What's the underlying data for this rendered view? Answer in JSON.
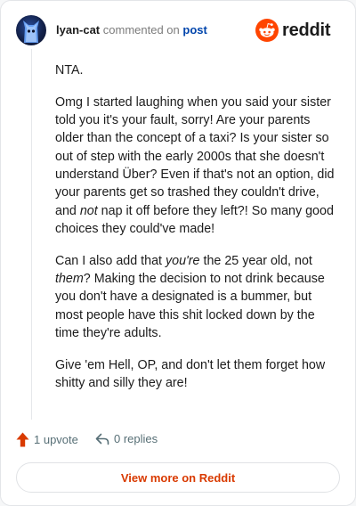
{
  "header": {
    "username": "lyan-cat",
    "action_text": "commented on",
    "target_link": "post",
    "brand_name": "reddit"
  },
  "comment": {
    "paragraphs": [
      [
        {
          "t": "NTA."
        }
      ],
      [
        {
          "t": "Omg I started laughing when you said your sister told you it's your fault, sorry! Are your parents older than the concept of a taxi? Is your sister so out of step with the early 2000s that she doesn't understand Über? Even if that's not an option, did your parents get so trashed they couldn't drive, and "
        },
        {
          "t": "not",
          "i": true
        },
        {
          "t": " nap it off before they left?! So many good choices they could've made!"
        }
      ],
      [
        {
          "t": "Can I also add that "
        },
        {
          "t": "you're",
          "i": true
        },
        {
          "t": " the 25 year old, not "
        },
        {
          "t": "them",
          "i": true
        },
        {
          "t": "? Making the decision to not drink because you don't have a designated is a bummer, but most people have this shit locked down by the time they're adults."
        }
      ],
      [
        {
          "t": "Give 'em Hell, OP, and don't let them forget how shitty and silly they are!"
        }
      ]
    ]
  },
  "actions": {
    "upvote_label": "1 upvote",
    "reply_label": "0 replies"
  },
  "footer": {
    "view_label": "View more on Reddit"
  },
  "colors": {
    "brand": "#ff4500",
    "link": "#0045ac",
    "upvote": "#d93a00",
    "muted": "#576f76"
  },
  "icons": {
    "brand": "reddit-snoo-icon",
    "upvote": "arrow-up-icon",
    "reply": "reply-arrow-icon"
  }
}
